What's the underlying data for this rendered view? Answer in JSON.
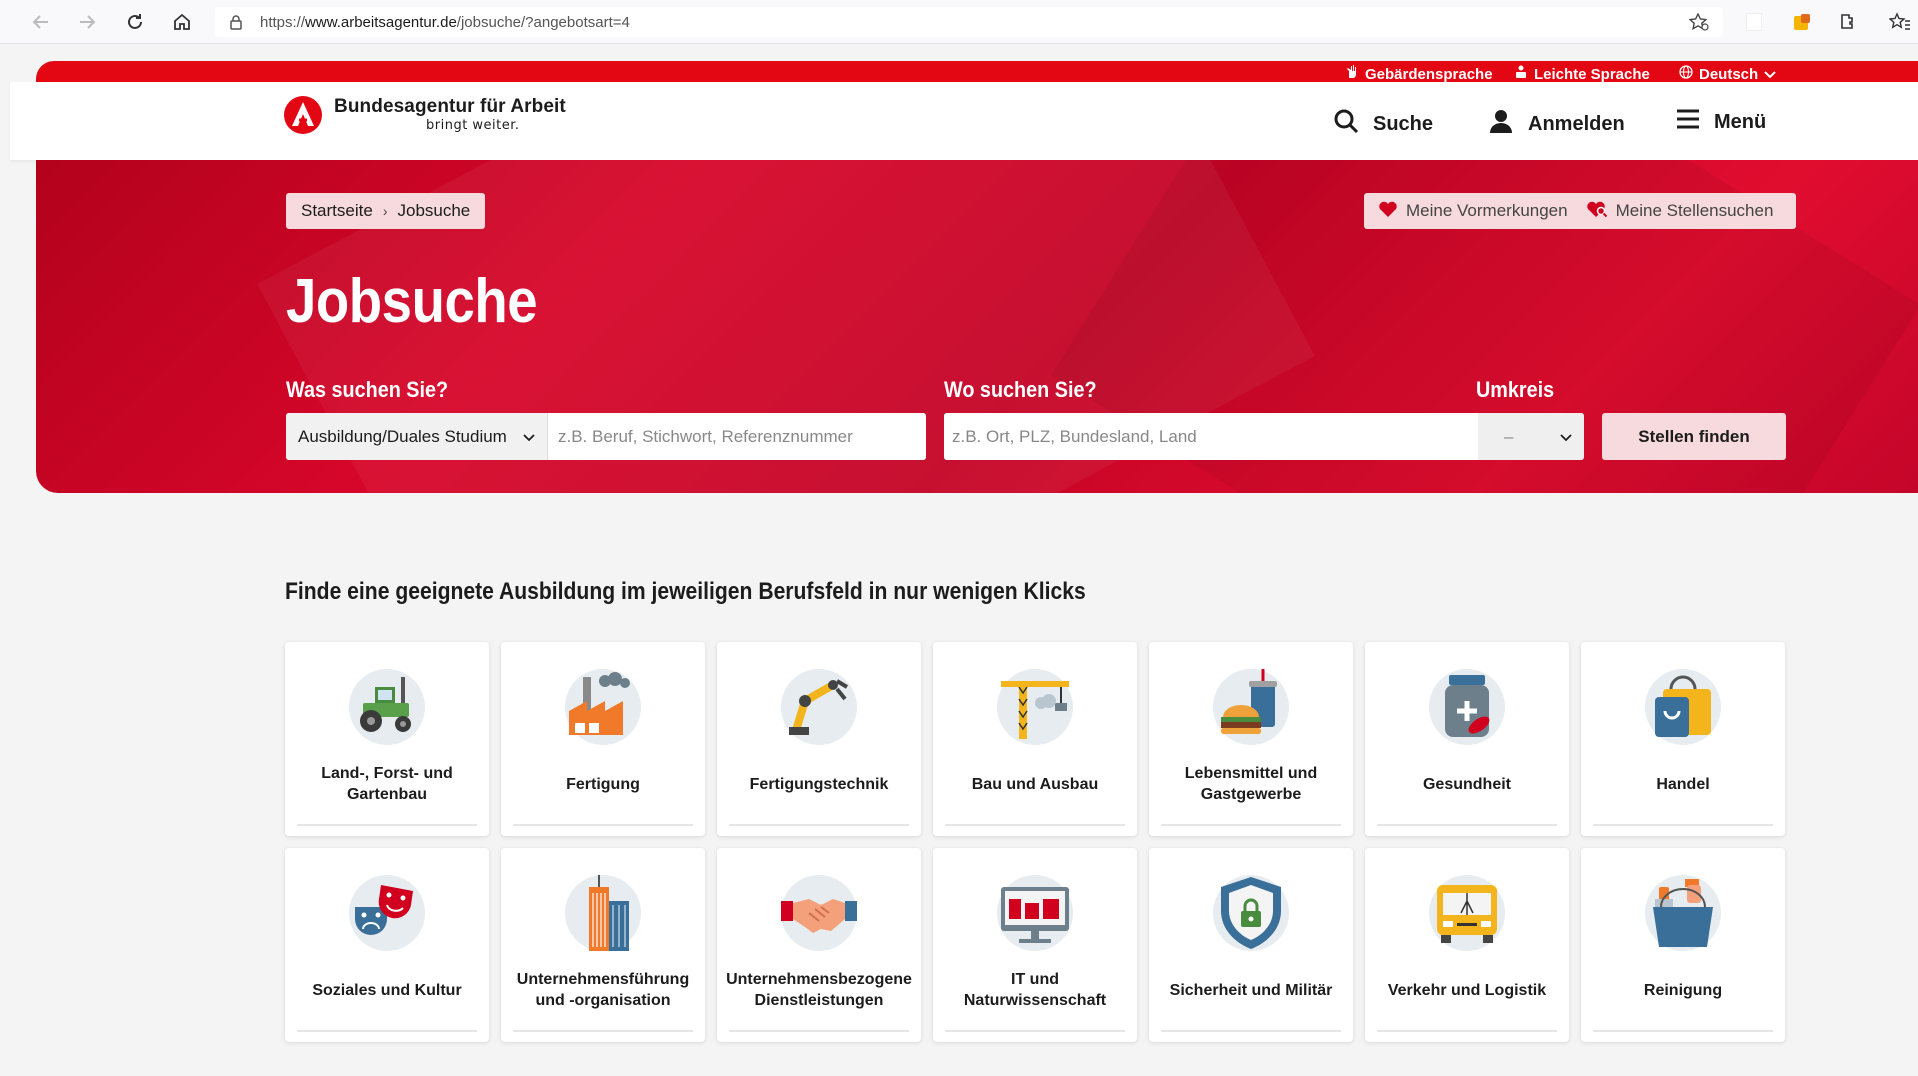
{
  "browser": {
    "url_prefix": "https://",
    "url_host": "www.arbeitsagentur.de",
    "url_path": "/jobsuche/?angebotsart=4"
  },
  "topbar": {
    "sign_language": "Gebärdensprache",
    "easy_language": "Leichte Sprache",
    "language": "Deutsch"
  },
  "header": {
    "logo_name": "Bundesagentur für Arbeit",
    "logo_slogan": "bringt weiter.",
    "search": "Suche",
    "login": "Anmelden",
    "menu": "Menü"
  },
  "breadcrumb": {
    "home": "Startseite",
    "separator": "›",
    "current": "Jobsuche"
  },
  "bookmarks": {
    "saved": "Meine Vormerkungen",
    "searches": "Meine Stellensuchen"
  },
  "hero": {
    "title": "Jobsuche",
    "what_label": "Was suchen Sie?",
    "where_label": "Wo suchen Sie?",
    "radius_label": "Umkreis",
    "type_selected": "Ausbildung/Duales Studium",
    "what_placeholder": "z.B. Beruf, Stichwort, Referenznummer",
    "where_placeholder": "z.B. Ort, PLZ, Bundesland, Land",
    "radius_selected": "–",
    "find_button": "Stellen finden"
  },
  "section": {
    "title": "Finde eine geeignete Ausbildung im jeweiligen Berufsfeld in nur wenigen Klicks"
  },
  "tiles": [
    {
      "label": "Land-, Forst- und Gartenbau",
      "icon": "tractor-icon"
    },
    {
      "label": "Fertigung",
      "icon": "factory-icon"
    },
    {
      "label": "Fertigungstechnik",
      "icon": "robot-arm-icon"
    },
    {
      "label": "Bau und Ausbau",
      "icon": "crane-icon"
    },
    {
      "label": "Lebensmittel und Gastgewerbe",
      "icon": "burger-drink-icon"
    },
    {
      "label": "Gesundheit",
      "icon": "medicine-jar-icon"
    },
    {
      "label": "Handel",
      "icon": "shopping-bag-icon"
    },
    {
      "label": "Soziales und Kultur",
      "icon": "theater-masks-icon"
    },
    {
      "label": "Unternehmensführung und -organisation",
      "icon": "skyscraper-icon"
    },
    {
      "label": "Unternehmensbezogene Dienstleistungen",
      "icon": "handshake-icon"
    },
    {
      "label": "IT und Naturwissenschaft",
      "icon": "monitor-chart-icon"
    },
    {
      "label": "Sicherheit und Militär",
      "icon": "shield-lock-icon"
    },
    {
      "label": "Verkehr und Logistik",
      "icon": "bus-icon"
    },
    {
      "label": "Reinigung",
      "icon": "cleaning-bucket-icon"
    }
  ],
  "colors": {
    "brand_red": "#e30613",
    "hero_red": "#c50426",
    "pink_button": "#f6dadd",
    "text": "#1c1c1c"
  }
}
